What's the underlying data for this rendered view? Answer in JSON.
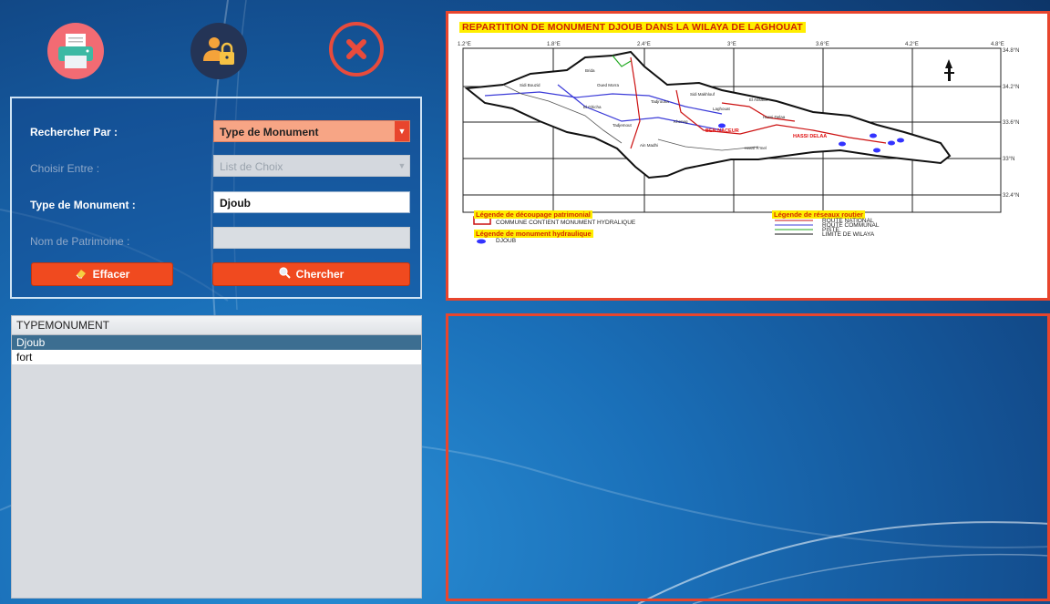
{
  "toolbar": {
    "print_icon": "printer-icon",
    "lock_icon": "user-lock-icon",
    "close_icon": "close-icon"
  },
  "search": {
    "rechercher_label": "Rechercher Par :",
    "rechercher_value": "Type de Monument",
    "choisir_label": "Choisir Entre :",
    "choisir_value": "List de Choix",
    "type_label": "Type de Monument :",
    "type_value": "Djoub",
    "nom_label": "Nom de Patrimoine :",
    "nom_value": "",
    "effacer_label": "Effacer",
    "chercher_label": "Chercher"
  },
  "list": {
    "header": "TYPEMONUMENT",
    "rows": [
      "Djoub",
      "fort"
    ],
    "selected_index": 0
  },
  "map": {
    "title": "REPARTITION DE MONUMENT DJOUB DANS LA WILAYA DE LAGHOUAT",
    "top_ticks": [
      "1.2°E",
      "1.8°E",
      "2.4°E",
      "3°E",
      "3.6°E",
      "4.2°E",
      "4.8°E"
    ],
    "right_ticks": [
      "34.8°N",
      "34.2°N",
      "33.6°N",
      "33°N",
      "32.4°N"
    ],
    "legend_decoupage_title": "Légende de découpage patrimonial",
    "legend_decoupage_item": "COMMUNE CONTIENT MONUMENT HYDRALIQUE",
    "legend_monument_title": "Légende de monument hydraulique",
    "legend_monument_item": "DJOUB",
    "legend_routes_title": "Légende de réseaux routier",
    "legend_routes_items": [
      "ROUTE NATIONAL",
      "ROUTE COMMUNAL",
      "PISTE",
      "LIMITE DE WILAYA"
    ],
    "place_names": [
      "Brida",
      "Sidi Bouzid",
      "Oued Morra",
      "Sidi Makhlouf",
      "Tadjrouna",
      "El Assafia",
      "Laghouat",
      "Kheneg",
      "Hassi Delaa",
      "Ain Madhi",
      "Hassi R'mel",
      "El Ghicha",
      "Tadjemout",
      "BEN NACEUR",
      "HASSI DELAA"
    ]
  },
  "colors": {
    "accent": "#e8452d",
    "selected_row": "#3c6e91",
    "title_highlight": "#ffee00"
  }
}
